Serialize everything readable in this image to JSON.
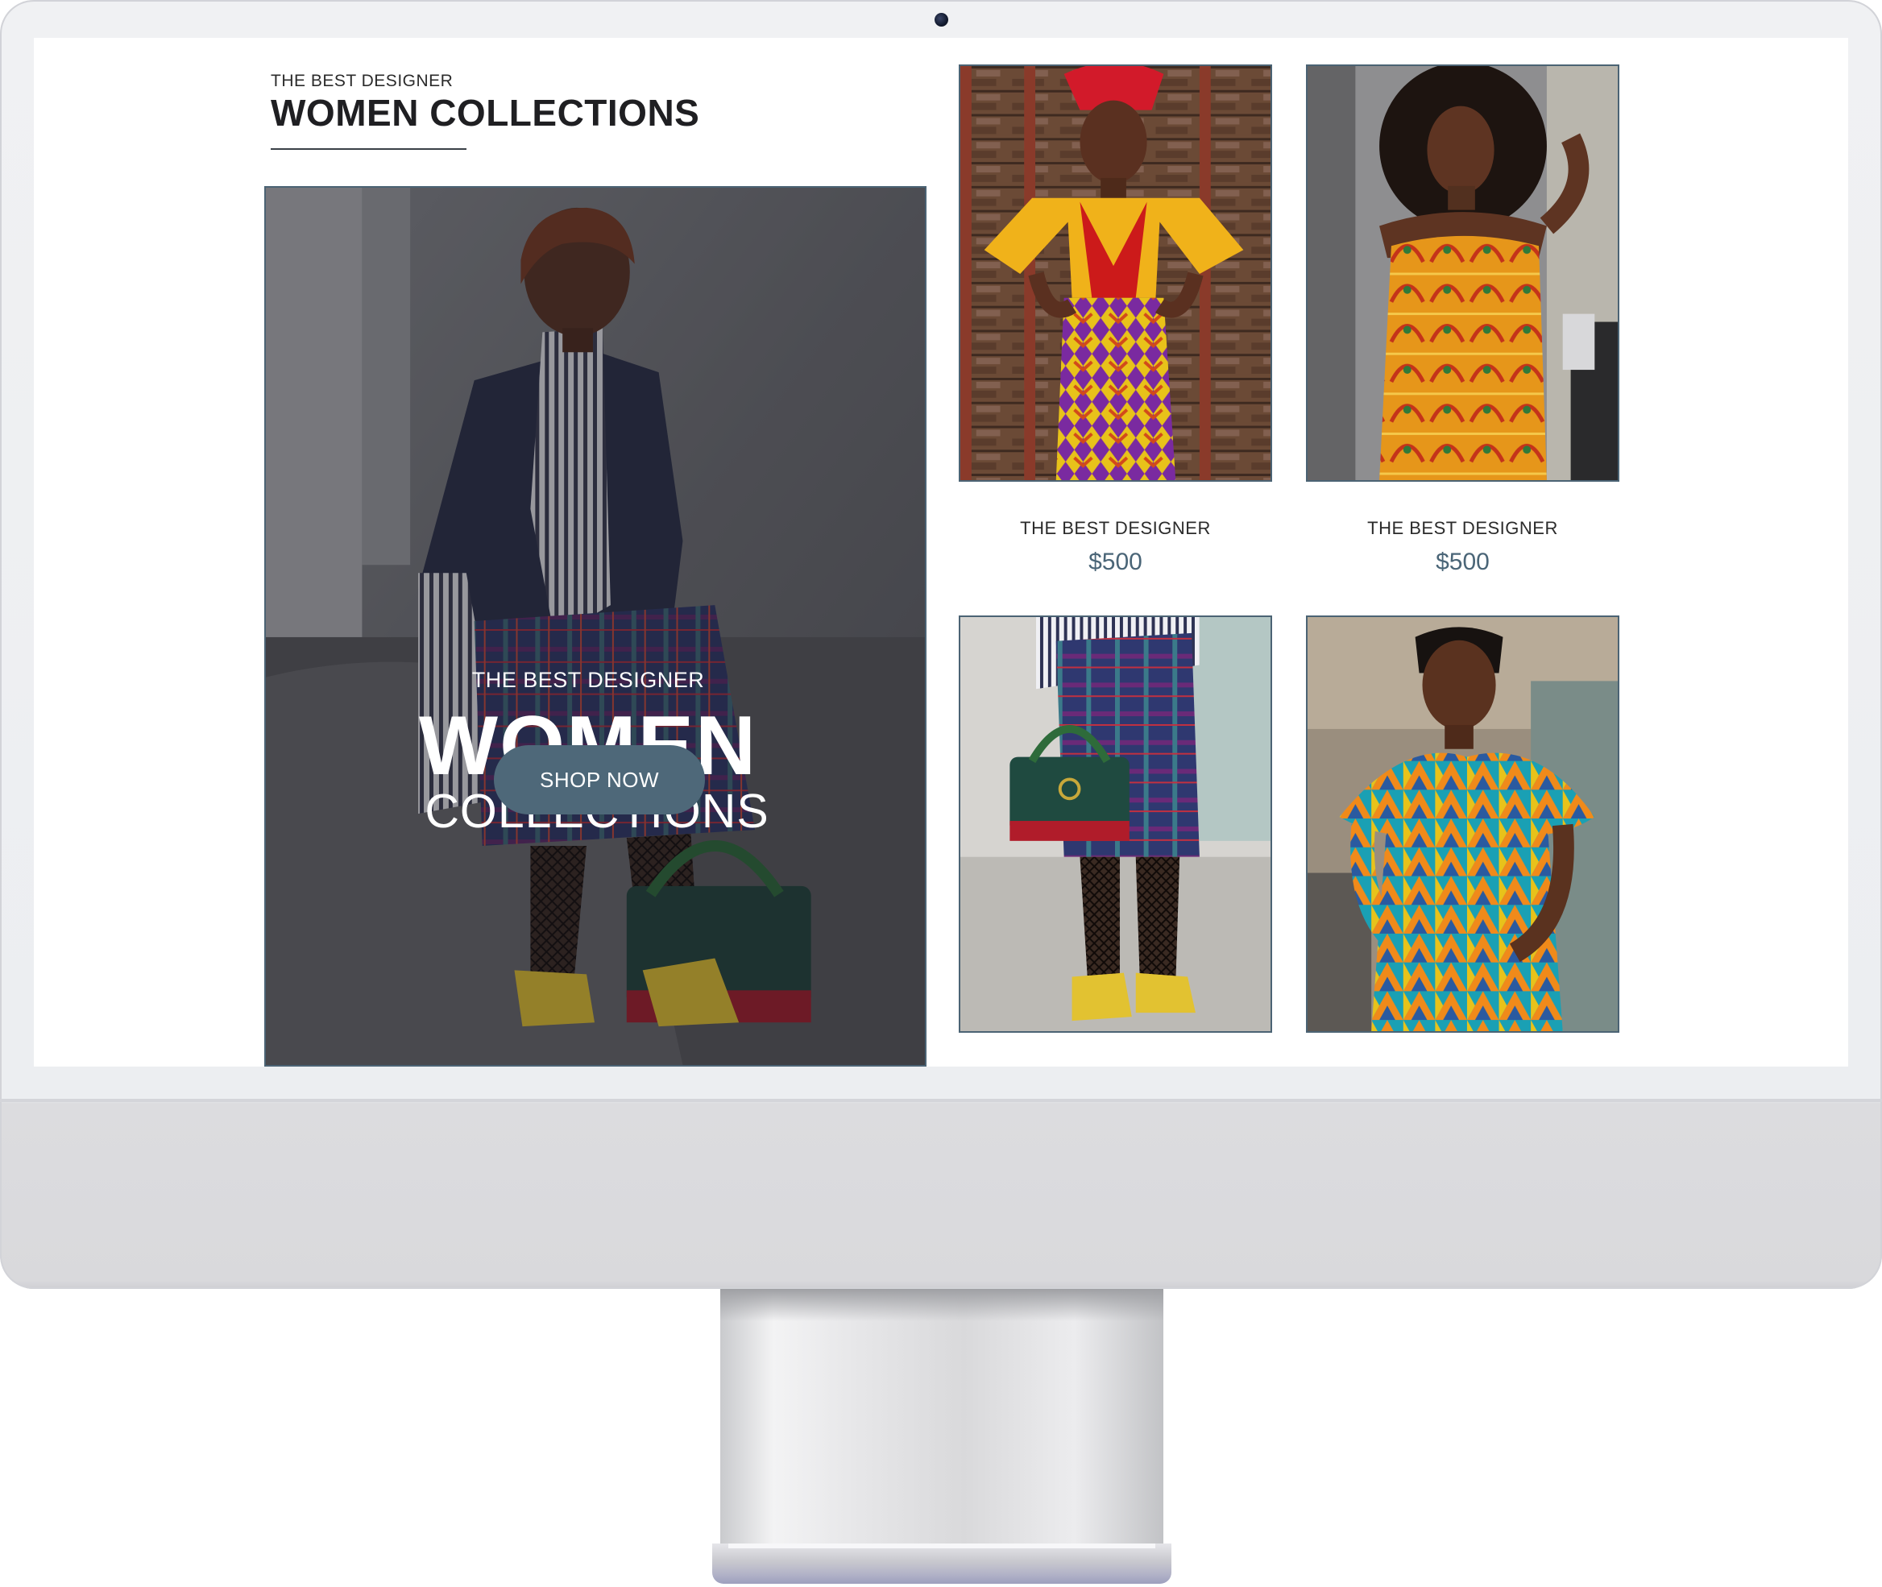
{
  "header": {
    "eyebrow": "THE BEST DESIGNER",
    "title": "WOMEN COLLECTIONS"
  },
  "hero": {
    "eyebrow": "THE BEST DESIGNER",
    "title": "WOMEN",
    "subtitle": "COLLECTIONS",
    "button_label": "SHOP NOW"
  },
  "products": [
    {
      "name": "THE BEST DESIGNER",
      "price": "$500"
    },
    {
      "name": "THE BEST DESIGNER",
      "price": "$500"
    }
  ],
  "theme": {
    "accent": "#4e6879",
    "price_color": "#4a6577",
    "border_color": "#4b6374",
    "text_dark": "#1f1f22"
  }
}
